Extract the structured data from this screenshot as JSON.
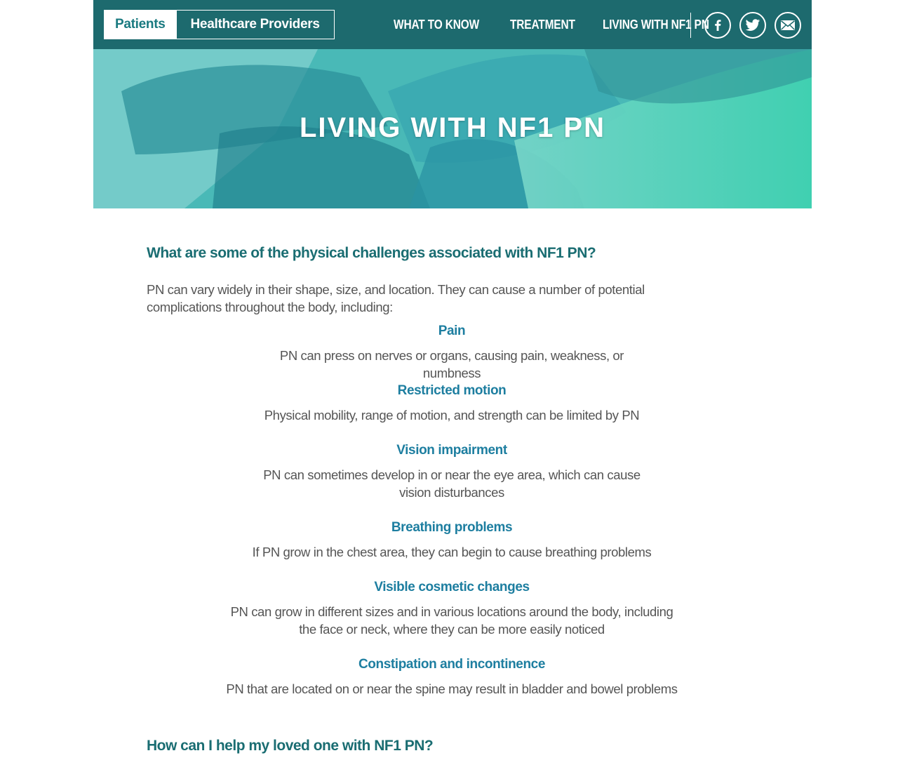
{
  "header": {
    "audience_active": "Patients",
    "audience_other": "Healthcare Providers",
    "nav": [
      "WHAT TO KNOW",
      "TREATMENT",
      "LIVING WITH NF1 PN"
    ],
    "social": [
      {
        "icon": "facebook-icon"
      },
      {
        "icon": "twitter-icon"
      },
      {
        "icon": "email-icon"
      }
    ]
  },
  "colors": {
    "header_bg": "#1d6a6e",
    "heading": "#1a6d72",
    "subheading": "#1d7ea0",
    "body_text": "#555555"
  },
  "hero": {
    "title": "LIVING WITH NF1 PN"
  },
  "main": {
    "question1": "What are some of the physical challenges associated with NF1 PN?",
    "intro": "PN can vary widely in their shape, size, and location. They can cause a number of potential complications throughout the body, including:",
    "items": [
      {
        "title": "Pain",
        "text": "PN can press on nerves or organs, causing pain, weakness, or numbness"
      },
      {
        "title": "Restricted motion",
        "text": "Physical mobility, range of motion, and strength can be limited by PN"
      },
      {
        "title": "Vision impairment",
        "text": "PN can sometimes develop in or near the eye area, which can cause vision disturbances"
      },
      {
        "title": "Breathing problems",
        "text": "If PN grow in the chest area, they can begin to cause breathing problems"
      },
      {
        "title": "Visible cosmetic changes",
        "text": "PN can grow in different sizes and in various locations around the body, including the face or neck, where they can be more easily noticed"
      },
      {
        "title": "Constipation and incontinence",
        "text": "PN that are located on or near the spine may result in bladder and bowel problems"
      }
    ],
    "question2": "How can I help my loved one with NF1 PN?"
  }
}
